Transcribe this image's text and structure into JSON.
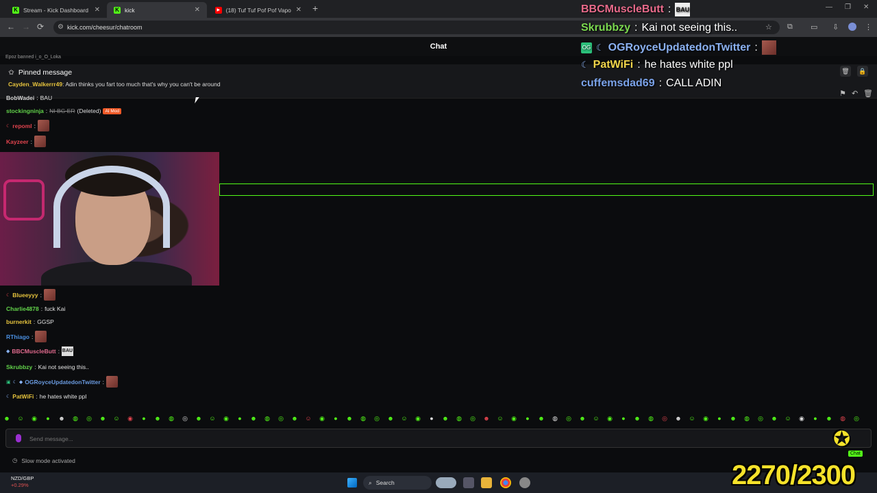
{
  "browser": {
    "tabs": [
      {
        "title": "Stream - Kick Dashboard",
        "icon": "kick-icon"
      },
      {
        "title": "kick",
        "icon": "kick-icon"
      },
      {
        "title": "(18) Tuf Tuf Pof Pof Vapo V...",
        "icon": "youtube-icon"
      }
    ],
    "url": "kick.com/cheesur/chatroom"
  },
  "chat": {
    "header": "Chat",
    "scroll_top": "Epoz banned i_o_O_Loka",
    "pinned": {
      "label": "Pinned message",
      "user": "Cayden_Walkerrr49",
      "text": "Adin thinks you fart too much that's why you can't be around"
    },
    "messages": [
      {
        "user": "BobWadei",
        "text": "BAU",
        "color": "#d7d7d7"
      },
      {
        "user": "stockingninja",
        "text": "NI BG ER",
        "deleted": "(Deleted)",
        "badge": "AI Mod",
        "color": "#62d34a"
      },
      {
        "user": "repoml",
        "text": "",
        "color": "#e0434d"
      },
      {
        "user": "Kayzeer",
        "text": "",
        "color": "#e0434d"
      },
      {
        "user": "Blueeyyy",
        "text": "",
        "color": "#e6c33d"
      },
      {
        "user": "Charlie4878",
        "text": "fuck Kai",
        "color": "#62d34a"
      },
      {
        "user": "burnerkit",
        "text": "GGSP",
        "color": "#e6c33d"
      },
      {
        "user": "RThiago",
        "text": "",
        "color": "#4a8fe0"
      },
      {
        "user": "BBCMuscleButt",
        "text": "",
        "color": "#e06a8d"
      },
      {
        "user": "Skrubbzy",
        "text": "Kai not seeing this..",
        "color": "#62d34a"
      },
      {
        "user": "OGRoyceUpdatedonTwitter",
        "text": "",
        "color": "#6a9be0"
      },
      {
        "user": "PatWiFi",
        "text": "he hates white ppl",
        "color": "#e6c33d"
      }
    ],
    "input_placeholder": "Send message...",
    "slow_mode": "Slow mode activated"
  },
  "overlay": {
    "lines": [
      {
        "user": "BBCMuscleButt",
        "text": "",
        "color": "#e86a8a"
      },
      {
        "user": "Skrubbzy",
        "text": "Kai not seeing this..",
        "color": "#7bd84f"
      },
      {
        "user": "OGRoyceUpdatedonTwitter",
        "text": "",
        "color": "#8ab0f0"
      },
      {
        "user": "PatWiFi",
        "text": "he hates white ppl",
        "color": "#f0d44a"
      },
      {
        "user": "cuffemsdad69",
        "text": "CALL ADIN",
        "color": "#7aa2e8"
      }
    ],
    "emote_text": "BAU",
    "counter": "2270/2300",
    "logo_tag": "Chat"
  },
  "taskbar": {
    "ticker_symbol": "NZD/GBP",
    "ticker_change": "+0.29%",
    "search_label": "Search"
  }
}
